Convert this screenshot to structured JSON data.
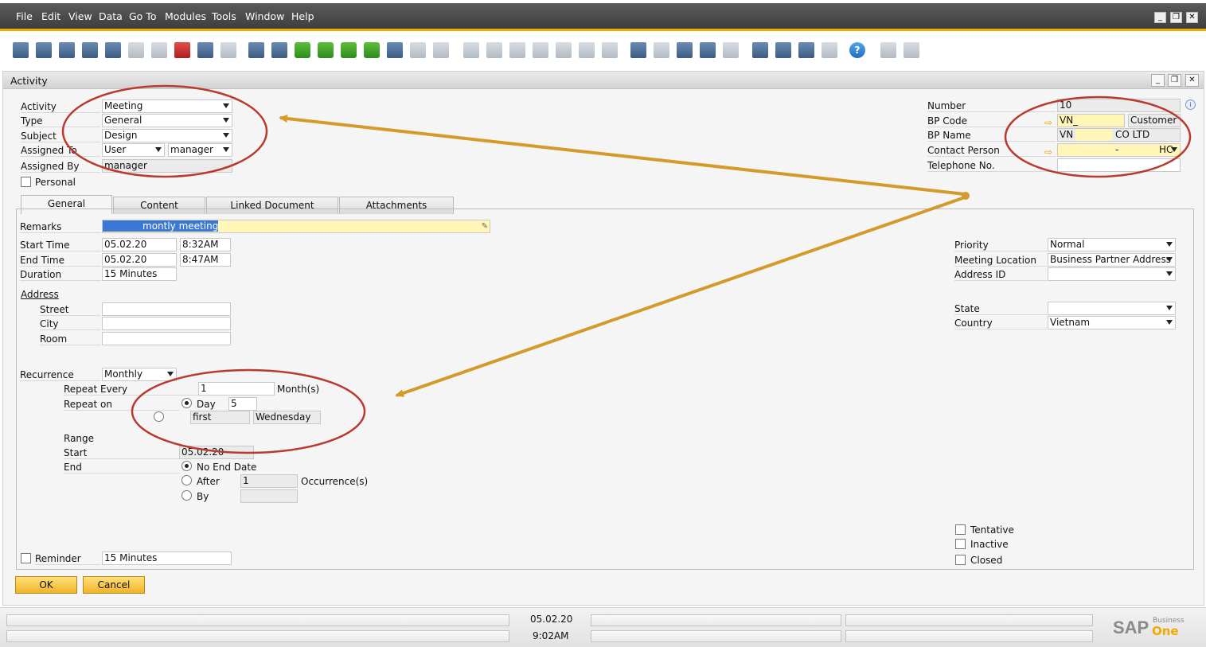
{
  "menu": [
    "File",
    "Edit",
    "View",
    "Data",
    "Go To",
    "Modules",
    "Tools",
    "Window",
    "Help"
  ],
  "window": {
    "title": "Activity"
  },
  "header_left": {
    "activity": {
      "label": "Activity",
      "value": "Meeting"
    },
    "type": {
      "label": "Type",
      "value": "General"
    },
    "subject": {
      "label": "Subject",
      "value": "Design"
    },
    "assigned_to": {
      "label": "Assigned To",
      "value1": "User",
      "value2": "manager"
    },
    "assigned_by": {
      "label": "Assigned By",
      "value": "manager"
    },
    "personal": {
      "label": "Personal"
    }
  },
  "header_right": {
    "number": {
      "label": "Number",
      "value": "10"
    },
    "bp_code": {
      "label": "BP Code",
      "value": "VN_",
      "type_value": "Customer"
    },
    "bp_name": {
      "label": "BP Name",
      "value1": "VN",
      "value2": "CO LTD"
    },
    "contact_person": {
      "label": "Contact Person",
      "value1": "-",
      "value2": "HC"
    },
    "telephone": {
      "label": "Telephone No.",
      "value": ""
    }
  },
  "tabs": [
    "General",
    "Content",
    "Linked Document",
    "Attachments"
  ],
  "general": {
    "remarks": {
      "label": "Remarks",
      "value": "montly meeting"
    },
    "start_time": {
      "label": "Start Time",
      "date": "05.02.20",
      "time": "8:32AM"
    },
    "end_time": {
      "label": "End Time",
      "date": "05.02.20",
      "time": "8:47AM"
    },
    "duration": {
      "label": "Duration",
      "value": "15 Minutes"
    },
    "address": {
      "label": "Address",
      "street": "Street",
      "city": "City",
      "room": "Room"
    },
    "recurrence": {
      "label": "Recurrence",
      "value": "Monthly"
    },
    "repeat_every": {
      "label": "Repeat Every",
      "value": "1",
      "unit": "Month(s)"
    },
    "repeat_on": {
      "label": "Repeat on",
      "day_label": "Day",
      "day_value": "5",
      "ordinal": "first",
      "weekday": "Wednesday"
    },
    "range": {
      "label": "Range",
      "start_label": "Start",
      "start_value": "05.02.20",
      "end_label": "End",
      "no_end": "No End Date",
      "after": "After",
      "after_value": "1",
      "occurrences": "Occurrence(s)",
      "by": "By"
    },
    "reminder": {
      "label": "Reminder",
      "value": "15 Minutes"
    },
    "priority": {
      "label": "Priority",
      "value": "Normal"
    },
    "meeting_location": {
      "label": "Meeting Location",
      "value": "Business Partner Address"
    },
    "address_id": {
      "label": "Address ID",
      "value": ""
    },
    "state": {
      "label": "State",
      "value": ""
    },
    "country": {
      "label": "Country",
      "value": "Vietnam"
    },
    "tentative": "Tentative",
    "inactive": "Inactive",
    "closed": "Closed"
  },
  "buttons": {
    "ok": "OK",
    "cancel": "Cancel"
  },
  "status": {
    "date": "05.02.20",
    "time": "9:02AM"
  },
  "brand": {
    "sap": "SAP",
    "business": "Business",
    "one": "One"
  },
  "colors": {
    "accent": "#f0ab00",
    "annotation": "#d49a2a",
    "highlight": "#fff6b8"
  }
}
